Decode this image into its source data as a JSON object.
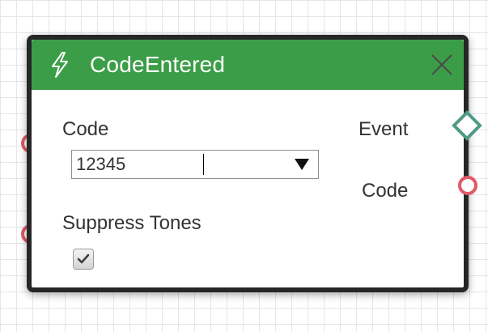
{
  "node": {
    "title": "CodeEntered",
    "icon": "lightning-bolt-icon",
    "header_color": "#3b9d47"
  },
  "inputs": {
    "code": {
      "label": "Code",
      "selected_value": "12345"
    },
    "suppress_tones": {
      "label": "Suppress Tones",
      "checked": true
    }
  },
  "outputs": {
    "event": {
      "label": "Event"
    },
    "code": {
      "label": "Code"
    }
  },
  "colors": {
    "data_port": "#e05a66",
    "event_port": "#4e9a86"
  }
}
